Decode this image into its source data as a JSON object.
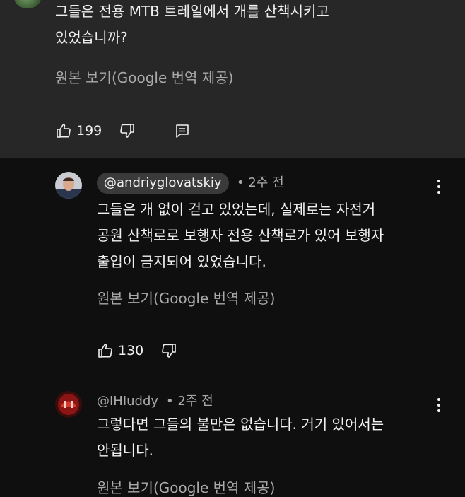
{
  "top_comment": {
    "text": "그들은 전용 MTB 트레일에서 개를 산책시키고\n있었습니까?",
    "translate_label": "원본 보기(Google 번역 제공)",
    "like_count": "199"
  },
  "replies": [
    {
      "author": "@andriyglovatskiy",
      "time": "• 2주 전",
      "text": "그들은 개 없이 걷고 있었는데, 실제로는 자전거\n공원 산책로로 보행자 전용 산책로가 있어 보행자\n출입이 금지되어 있었습니다.",
      "translate_label": "원본 보기(Google 번역 제공)",
      "like_count": "130"
    },
    {
      "author": "@IHIuddy",
      "time": "• 2주 전",
      "text": "그렇다면 그들의 불만은 없습니다. 거기 있어서는\n안됩니다.",
      "translate_label": "원본 보기(Google 번역 제공)"
    }
  ],
  "icons": {
    "like": "thumbs-up-icon",
    "dislike": "thumbs-down-icon",
    "reply": "comment-icon",
    "more": "more-vert-icon"
  },
  "colors": {
    "background": "#0f0f0f",
    "highlight_background": "#272727",
    "secondary_text": "#aaaaaa",
    "chip_background": "#3a3a3a"
  }
}
